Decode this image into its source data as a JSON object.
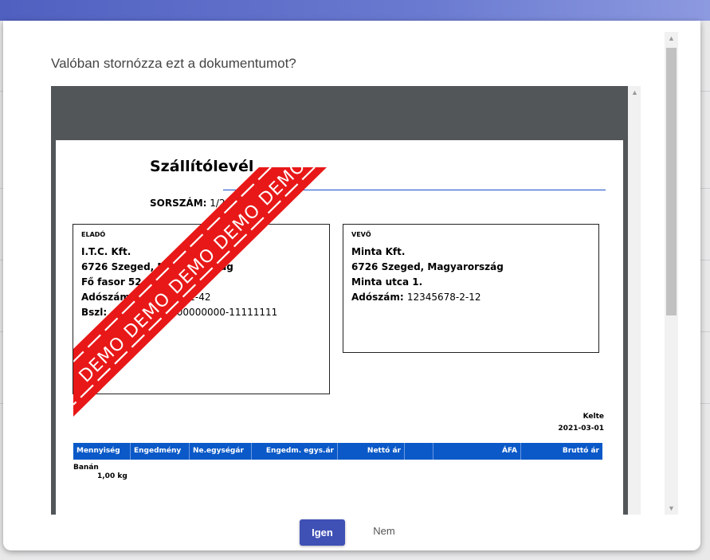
{
  "dialog": {
    "title": "Valóban stornózza ezt a dokumentumot?",
    "confirm_label": "Igen",
    "cancel_label": "Nem"
  },
  "document": {
    "title": "Szállítólevél",
    "serial_label": "SORSZÁM:",
    "serial_value": "1/21",
    "watermark_text": "DEMO DEMO DEMO DEMO DEMO",
    "seller": {
      "header": "ELADÓ",
      "name": "I.T.C. Kft.",
      "city": "6726 Szeged, Magyarország",
      "street": "Fő fasor 52.",
      "tax_label": "Adószám:",
      "tax_value": "11082376-2-42",
      "bank_label": "Bszl:",
      "bank_value": "11111111-00000000-11111111"
    },
    "buyer": {
      "header": "VEVŐ",
      "name": "Minta Kft.",
      "city": "6726 Szeged, Magyarország",
      "street": "Minta utca 1.",
      "tax_label": "Adószám:",
      "tax_value": "12345678-2-12"
    },
    "date_label": "Kelte",
    "date_value": "2021-03-01",
    "table": {
      "headers": [
        "Mennyiség",
        "Engedmény",
        "Ne.egységár",
        "Engedm. egys.ár",
        "Nettó ár",
        "",
        "ÁFA",
        "Bruttó ár"
      ],
      "rows": [
        {
          "name": "Banán",
          "qty": "1,00 kg"
        }
      ]
    }
  }
}
